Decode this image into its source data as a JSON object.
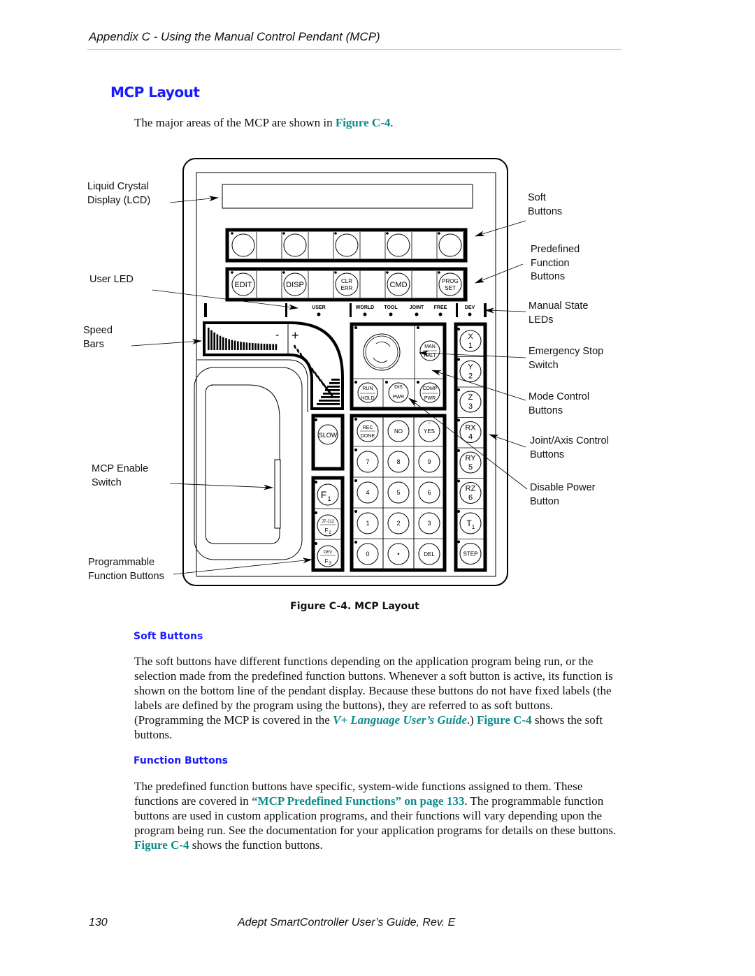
{
  "header": {
    "running_head": "Appendix C - Using the Manual Control Pendant (MCP)"
  },
  "section": {
    "title": "MCP Layout",
    "intro_before": "The major areas of the MCP are shown in ",
    "intro_link": "Figure C-4",
    "intro_after": "."
  },
  "figure": {
    "caption": "Figure C-4. MCP Layout",
    "callouts_left": [
      {
        "id": "lcd",
        "line1": "Liquid Crystal",
        "line2": "Display (LCD)"
      },
      {
        "id": "user-led",
        "line1": "User LED",
        "line2": ""
      },
      {
        "id": "speed-bars",
        "line1": "Speed",
        "line2": "Bars"
      },
      {
        "id": "enable-switch",
        "line1": "MCP Enable",
        "line2": "Switch"
      },
      {
        "id": "prog-func",
        "line1": "Programmable",
        "line2": "Function Buttons"
      }
    ],
    "callouts_right": [
      {
        "id": "soft-buttons",
        "line1": "Soft",
        "line2": "Buttons",
        "line3": ""
      },
      {
        "id": "predefined",
        "line1": "Predefined",
        "line2": "Function",
        "line3": "Buttons"
      },
      {
        "id": "manual-state",
        "line1": "Manual State",
        "line2": "LEDs",
        "line3": ""
      },
      {
        "id": "estop",
        "line1": "Emergency Stop",
        "line2": "Switch",
        "line3": ""
      },
      {
        "id": "mode-control",
        "line1": "Mode Control",
        "line2": "Buttons",
        "line3": ""
      },
      {
        "id": "joint-axis",
        "line1": "Joint/Axis Control",
        "line2": "Buttons",
        "line3": ""
      },
      {
        "id": "disable-power",
        "line1": "Disable Power",
        "line2": "Button",
        "line3": ""
      }
    ],
    "predefined_buttons": [
      {
        "top": "EDIT",
        "bottom": ""
      },
      {
        "top": "DISP",
        "bottom": ""
      },
      {
        "top": "CLR",
        "bottom": "ERR"
      },
      {
        "top": "CMD",
        "bottom": ""
      },
      {
        "top": "PROG",
        "bottom": "SET"
      }
    ],
    "state_leds": {
      "user": "USER",
      "modes": [
        "WORLD",
        "TOOL",
        "JOINT",
        "FREE"
      ],
      "dev": "DEV"
    },
    "speed": {
      "minus": "-",
      "plus": "+"
    },
    "mode_buttons": {
      "man_halt": [
        "MAN",
        "HALT"
      ],
      "run_hold": [
        "RUN",
        "HOLD"
      ],
      "dis_pwr": [
        "DIS",
        "PWR"
      ],
      "comp_pwr": [
        "COMP",
        "PWR"
      ]
    },
    "slow": "SLOW",
    "function_keys": [
      {
        "main": "F",
        "sub": "1",
        "extra": ""
      },
      {
        "main": "F",
        "sub": "2",
        "extra": "J7-J12"
      },
      {
        "main": "F",
        "sub": "3",
        "extra": "DEV"
      }
    ],
    "keypad": [
      [
        "REC/DONE",
        "NO",
        "YES"
      ],
      [
        "7",
        "8",
        "9"
      ],
      [
        "4",
        "5",
        "6"
      ],
      [
        "1",
        "2",
        "3"
      ],
      [
        "0",
        "•",
        "DEL"
      ]
    ],
    "keypad_row0": {
      "rec": "REC",
      "done": "DONE",
      "no": "NO",
      "yes": "YES",
      "minus": "−",
      "plus": "+"
    },
    "axis_buttons": [
      {
        "top": "X",
        "bottom": "1"
      },
      {
        "top": "Y",
        "bottom": "2"
      },
      {
        "top": "Z",
        "bottom": "3"
      },
      {
        "top": "RX",
        "bottom": "4"
      },
      {
        "top": "RY",
        "bottom": "5"
      },
      {
        "top": "RZ",
        "bottom": "6"
      },
      {
        "top": "T",
        "bottom": "1"
      },
      {
        "top": "STEP",
        "bottom": ""
      }
    ]
  },
  "soft_buttons_section": {
    "heading": "Soft Buttons",
    "p1": "The soft buttons have different functions depending on the application program being run, or the selection made from the predefined function buttons. Whenever a soft button is active, its function is shown on the bottom line of the pendant display. Because these buttons do not have fixed labels (the labels are defined by the program using the buttons), they are referred to as soft buttons. (Programming the MCP is covered in the ",
    "link_guide": "V+ Language User’s Guide",
    "p2": ".) ",
    "link_fig": "Figure C-4",
    "p3": " shows the soft buttons."
  },
  "function_buttons_section": {
    "heading": "Function Buttons",
    "p1": "The predefined function buttons have specific, system-wide functions assigned to them. These functions are covered in ",
    "link_ref": "“MCP Predefined Functions” on page 133",
    "p2": ". The programmable function buttons are used in custom application programs, and their functions will vary depending upon the program being run. See the documentation for your application programs for details on these buttons. ",
    "link_fig": "Figure C-4",
    "p3": " shows the function buttons."
  },
  "footer": {
    "page_number": "130",
    "doc_title": "Adept SmartController User’s Guide, Rev. E"
  }
}
